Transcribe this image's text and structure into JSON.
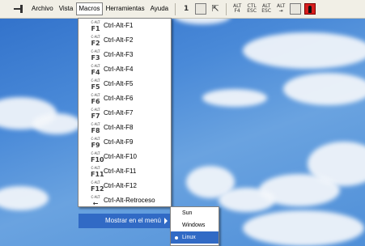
{
  "toolbar": {
    "menus": [
      "Archivo",
      "Vista",
      "Macros",
      "Herramientas",
      "Ayuda"
    ],
    "active_menu": "Macros",
    "buttons": [
      {
        "icon": "one-to-one-cursor-icon",
        "text": "1"
      },
      {
        "icon": "window-icon",
        "text": ""
      },
      {
        "icon": "cursor-icon",
        "text": ""
      },
      {
        "icon": "alt-f4-key-icon",
        "text": "ALT F4"
      },
      {
        "icon": "ctl-esc-key-icon",
        "text": "CTL ESC"
      },
      {
        "icon": "alt-esc-key-icon",
        "text": "ALT ESC"
      },
      {
        "icon": "alt-tab-key-icon",
        "text": "ALT ⇥"
      },
      {
        "icon": "monitor-icon",
        "text": ""
      },
      {
        "icon": "exit-icon",
        "text": ""
      }
    ]
  },
  "macros_menu": {
    "items": [
      {
        "key_top": "C-ALT",
        "key": "F1",
        "label": "Ctrl-Alt-F1"
      },
      {
        "key_top": "C-ALT",
        "key": "F2",
        "label": "Ctrl-Alt-F2"
      },
      {
        "key_top": "C-ALT",
        "key": "F3",
        "label": "Ctrl-Alt-F3"
      },
      {
        "key_top": "C-ALT",
        "key": "F4",
        "label": "Ctrl-Alt-F4"
      },
      {
        "key_top": "C-ALT",
        "key": "F5",
        "label": "Ctrl-Alt-F5"
      },
      {
        "key_top": "C-ALT",
        "key": "F6",
        "label": "Ctrl-Alt-F6"
      },
      {
        "key_top": "C-ALT",
        "key": "F7",
        "label": "Ctrl-Alt-F7"
      },
      {
        "key_top": "C-ALT",
        "key": "F8",
        "label": "Ctrl-Alt-F8"
      },
      {
        "key_top": "C-ALT",
        "key": "F9",
        "label": "Ctrl-Alt-F9"
      },
      {
        "key_top": "C-ALT",
        "key": "F10",
        "label": "Ctrl-Alt-F10"
      },
      {
        "key_top": "C-ALT",
        "key": "F11",
        "label": "Ctrl-Alt-F11"
      },
      {
        "key_top": "C-ALT",
        "key": "F12",
        "label": "Ctrl-Alt-F12"
      },
      {
        "key_top": "C-ALT",
        "key": "←",
        "label": "Ctrl-Alt-Retroceso"
      }
    ],
    "show_in_menu_label": "Mostrar en el menú"
  },
  "submenu": {
    "options": [
      "Sun",
      "Windows",
      "Linux"
    ],
    "selected": "Linux"
  },
  "colors": {
    "highlight": "#316ac5",
    "toolbar_bg": "#f1efe6",
    "desktop_sky": "#4a8ad8"
  }
}
